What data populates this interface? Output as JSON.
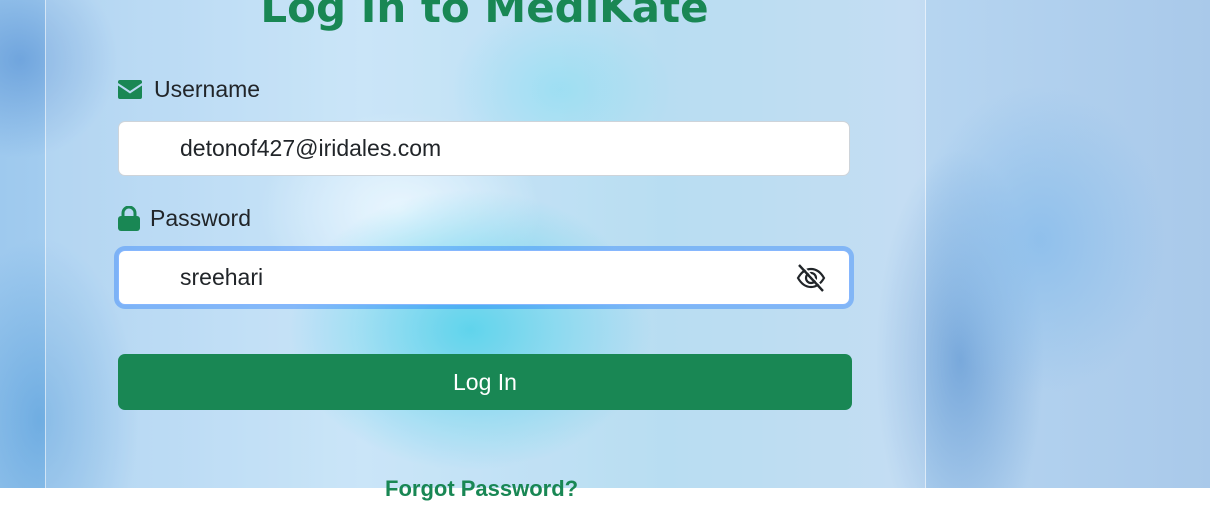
{
  "page": {
    "title": "Log In to MediKate"
  },
  "form": {
    "username": {
      "label": "Username",
      "icon": "envelope-icon",
      "value": "detonof427@iridales.com"
    },
    "password": {
      "label": "Password",
      "icon": "lock-icon",
      "value": "sreehari",
      "toggle_icon": "eye-slash-icon"
    },
    "submit_label": "Log In",
    "forgot_label": "Forgot Password?"
  },
  "colors": {
    "brand": "#198754",
    "focus_ring": "#86b7fe"
  }
}
